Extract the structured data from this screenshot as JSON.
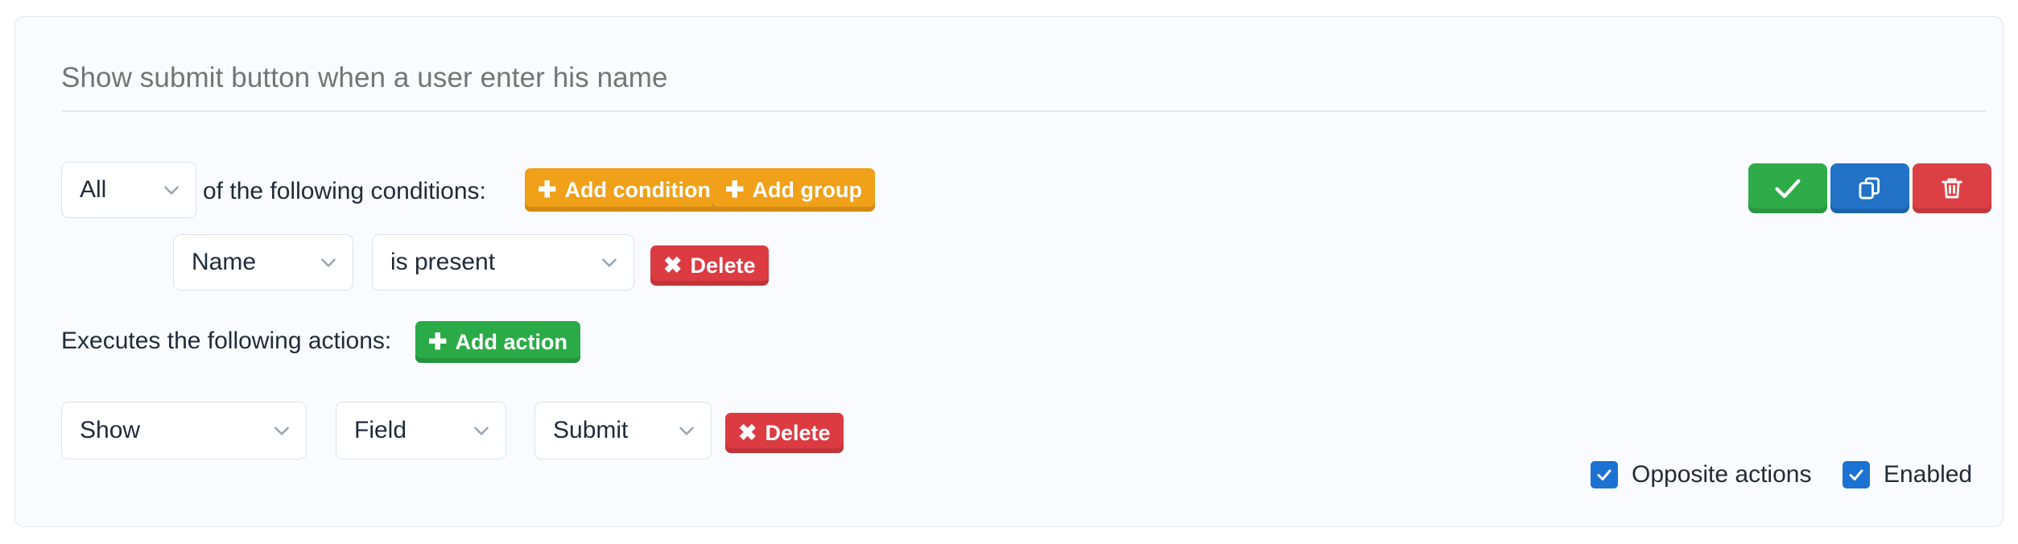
{
  "rule": {
    "title_value": "Show submit button when a user enter his name",
    "title_placeholder": "Show submit button when a user enter his name"
  },
  "conditions": {
    "match_select_value": "All",
    "match_text": "of the following conditions:",
    "add_condition_label": "Add condition",
    "add_group_label": "Add group",
    "add_icon": "plus-icon",
    "rows": [
      {
        "field_value": "Name",
        "operator_value": "is present",
        "delete_label": "Delete",
        "delete_icon": "times-icon"
      }
    ]
  },
  "actions": {
    "heading": "Executes the following actions:",
    "add_action_label": "Add action",
    "add_icon": "plus-icon",
    "rows": [
      {
        "action_value": "Show",
        "target_type_value": "Field",
        "target_value": "Submit",
        "delete_label": "Delete",
        "delete_icon": "times-icon"
      }
    ]
  },
  "toolbar": {
    "save_icon": "check-icon",
    "duplicate_icon": "copy-icon",
    "delete_icon": "trash-icon"
  },
  "options": [
    {
      "label": "Opposite actions",
      "checked": true
    },
    {
      "label": "Enabled",
      "checked": true
    }
  ],
  "colors": {
    "orange": "#f0a019",
    "green": "#2aab47",
    "red": "#dc3b42",
    "blue": "#2272c8",
    "checkbox_blue": "#1b72d2",
    "card_bg": "#fafbfe",
    "border": "#e2e6ee",
    "text": "#1f2b3a",
    "placeholder": "#9aa4b2"
  }
}
